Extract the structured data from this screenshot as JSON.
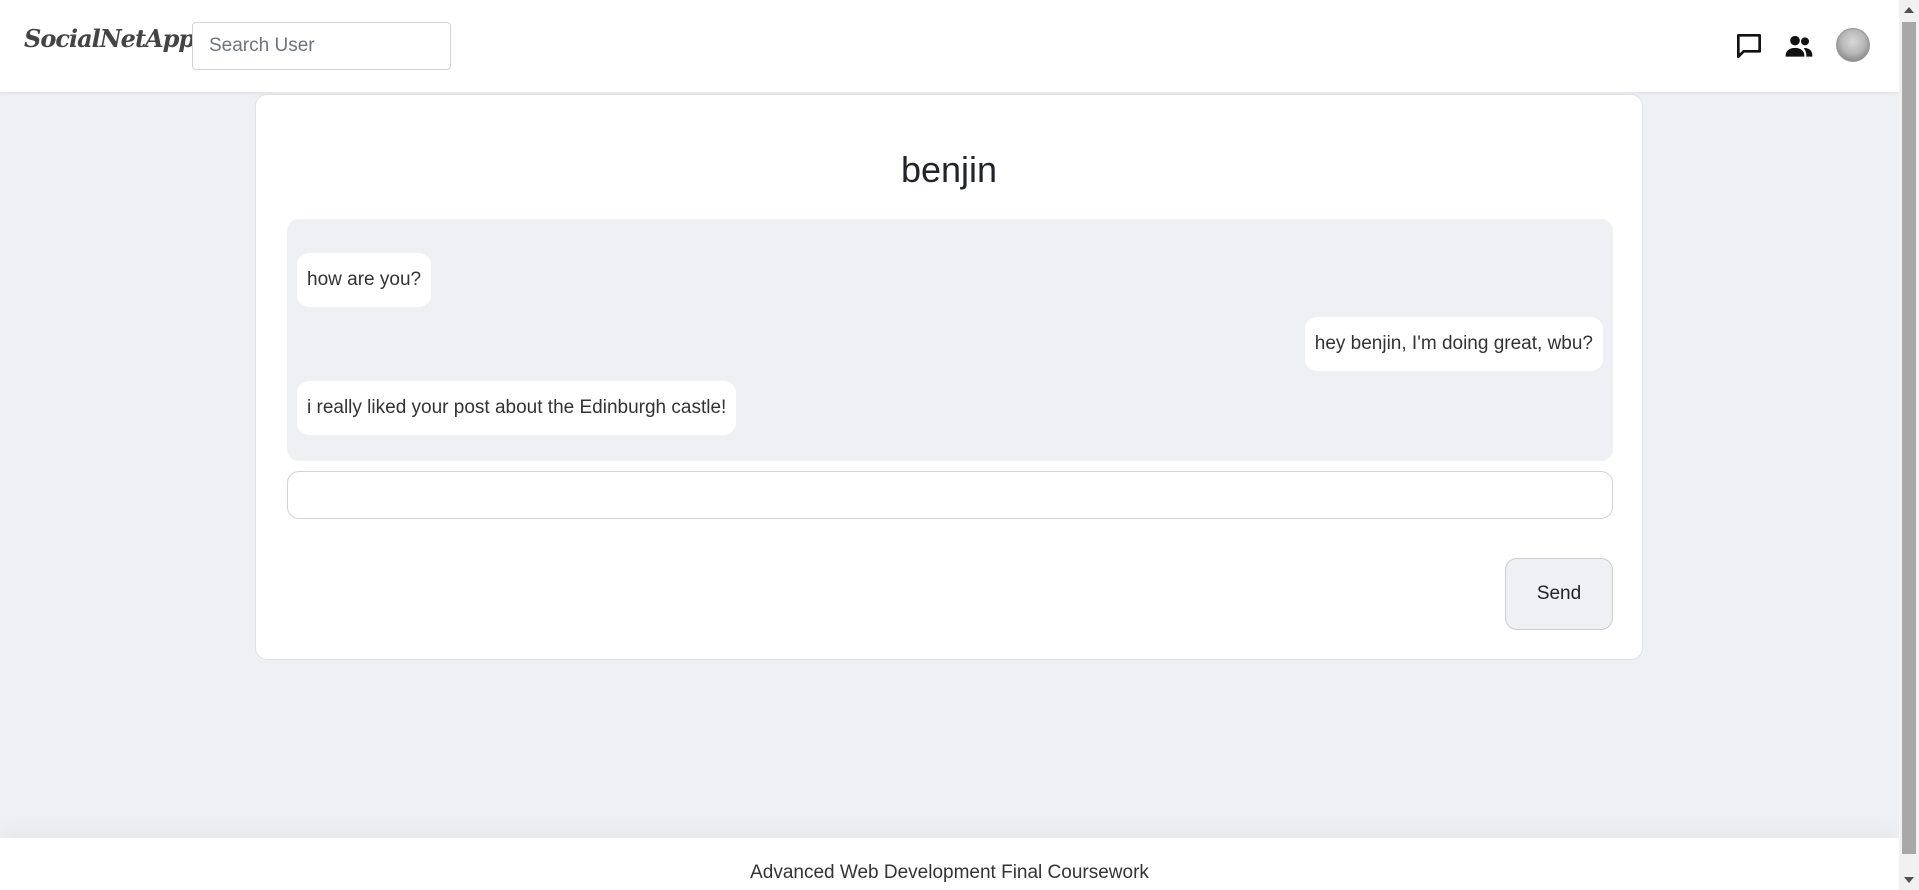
{
  "navbar": {
    "brand": "SocialNetApp",
    "search_placeholder": "Search User",
    "icons": [
      "chat-icon",
      "people-icon",
      "avatar"
    ]
  },
  "chat": {
    "title": "benjin",
    "messages": [
      {
        "text": "how are you?",
        "side": "left"
      },
      {
        "text": "hey benjin, I'm doing great, wbu?",
        "side": "right"
      },
      {
        "text": "i really liked your post about the Edinburgh castle!",
        "side": "left"
      }
    ],
    "input_value": "",
    "send_label": "Send"
  },
  "footer": {
    "text": "Advanced Web Development Final Coursework"
  },
  "colors": {
    "background": "#eef0f3",
    "card": "#ffffff",
    "bubble": "#ffffff",
    "text": "#212529"
  }
}
